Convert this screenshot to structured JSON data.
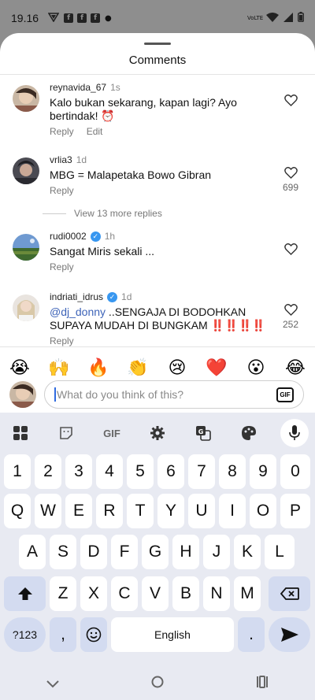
{
  "status_bar": {
    "time": "19.16",
    "network_label": "VoLTE"
  },
  "sheet": {
    "title": "Comments"
  },
  "comments": [
    {
      "username": "reynavida_67",
      "verified": false,
      "time": "1s",
      "text": "Kalo bukan sekarang, kapan lagi? Ayo bertindak! ⏰",
      "actions": [
        "Reply",
        "Edit"
      ],
      "likes": ""
    },
    {
      "username": "vrlia3",
      "verified": false,
      "time": "1d",
      "text": "MBG = Malapetaka Bowo Gibran",
      "actions": [
        "Reply"
      ],
      "likes": "699",
      "view_replies": "View 13 more replies"
    },
    {
      "username": "rudi0002",
      "verified": true,
      "time": "1h",
      "text": "Sangat Miris sekali ...",
      "actions": [
        "Reply"
      ],
      "likes": ""
    },
    {
      "username": "indriati_idrus",
      "verified": true,
      "time": "1d",
      "mention": "@dj_donny",
      "text": " ..SENGAJA DI BODOHKAN SUPAYA MUDAH DI BUNGKAM ‼️‼️‼️‼️",
      "actions": [
        "Reply"
      ],
      "likes": "252"
    }
  ],
  "emoji_bar": [
    "😭",
    "🙌",
    "🔥",
    "👏",
    "😢",
    "❤️",
    "😮",
    "😂"
  ],
  "composer": {
    "placeholder": "What do you think of this?",
    "gif_label": "GIF"
  },
  "keyboard": {
    "toolbar": {
      "gif_label": "GIF"
    },
    "rows": {
      "numbers": [
        "1",
        "2",
        "3",
        "4",
        "5",
        "6",
        "7",
        "8",
        "9",
        "0"
      ],
      "row1": [
        "Q",
        "W",
        "E",
        "R",
        "T",
        "Y",
        "U",
        "I",
        "O",
        "P"
      ],
      "row2": [
        "A",
        "S",
        "D",
        "F",
        "G",
        "H",
        "J",
        "K",
        "L"
      ],
      "row3": [
        "Z",
        "X",
        "C",
        "V",
        "B",
        "N",
        "M"
      ]
    },
    "symbols_label": "?123",
    "comma_label": ",",
    "space_label": "English",
    "period_label": "."
  },
  "colors": {
    "accent": "#3897f0",
    "mention": "#3d63b8",
    "keyboard_bg": "#e8eaf2",
    "special_key": "#d3dbf0"
  }
}
